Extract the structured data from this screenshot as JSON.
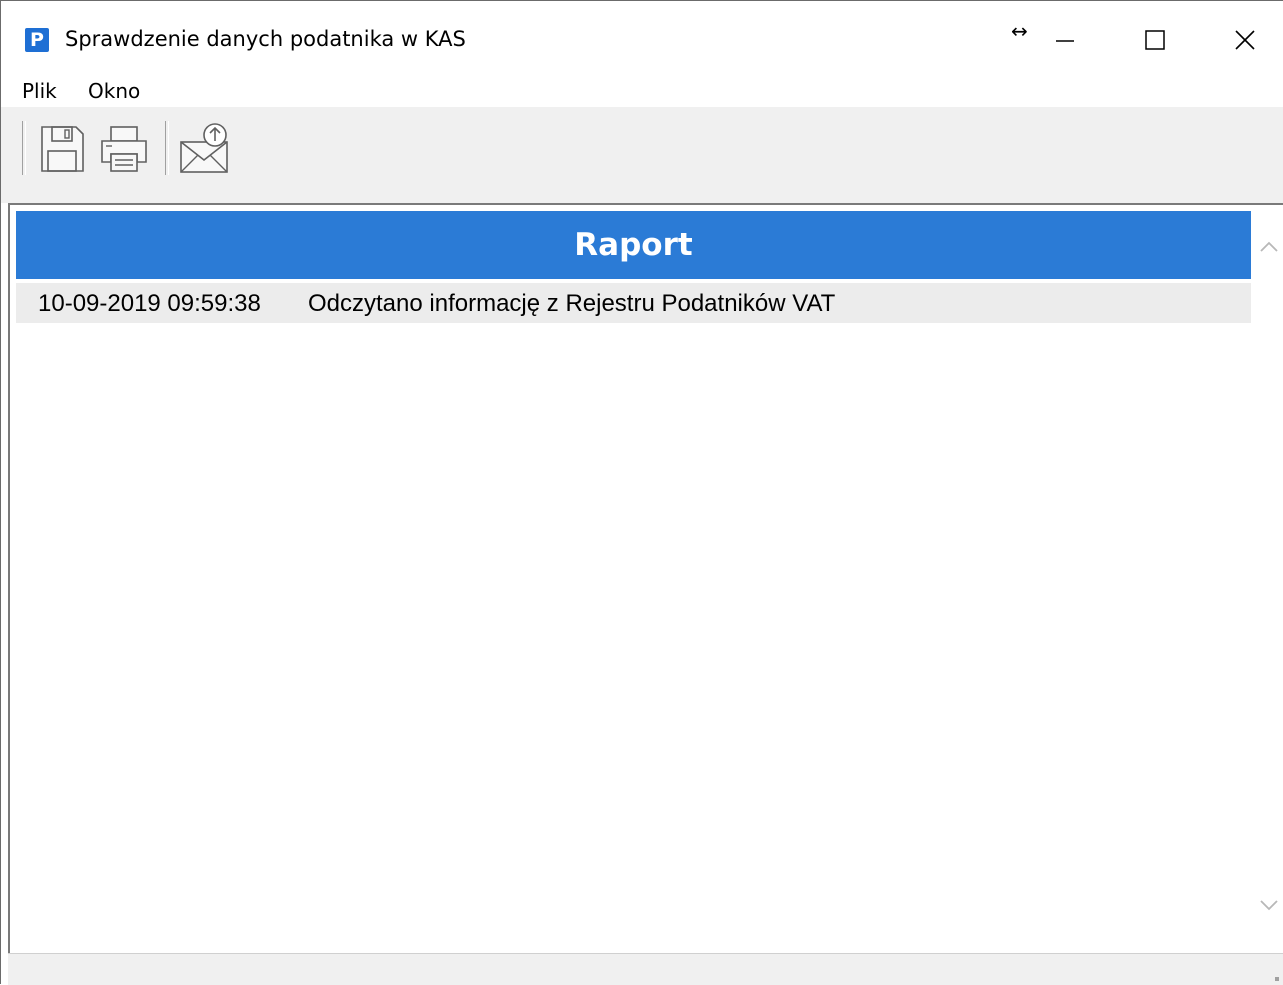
{
  "window": {
    "title": "Sprawdzenie danych podatnika w KAS",
    "app_icon_letter": "P",
    "accent_color": "#2b7bd6"
  },
  "menu": {
    "items": [
      {
        "label": "Plik"
      },
      {
        "label": "Okno"
      }
    ]
  },
  "toolbar": {
    "buttons": [
      {
        "icon": "save-icon"
      },
      {
        "icon": "print-icon"
      },
      {
        "icon": "send-mail-icon"
      }
    ]
  },
  "report": {
    "header": "Raport",
    "rows": [
      {
        "timestamp": "10-09-2019 09:59:38",
        "message": "Odczytano informację z Rejestru Podatników VAT"
      }
    ]
  }
}
